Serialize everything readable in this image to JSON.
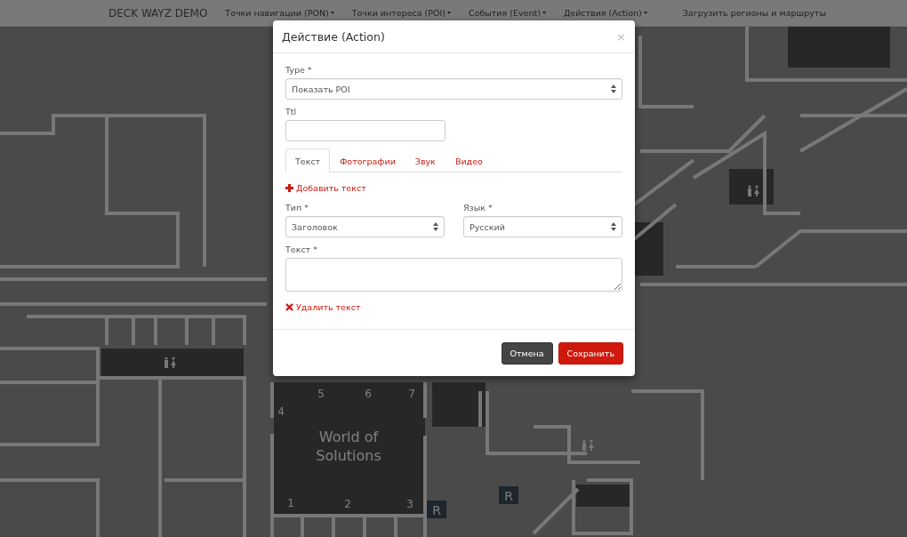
{
  "navbar": {
    "brand": "DECK WAYZ DEMO",
    "menus": [
      {
        "label": "Точки навигации (PON)"
      },
      {
        "label": "Точки интереса (POI)"
      },
      {
        "label": "События (Event)"
      },
      {
        "label": "Действия (Action)"
      }
    ],
    "right_link": "Загрузить регионы и маршруты"
  },
  "map": {
    "labels": [
      {
        "kind": "number",
        "lines": [
          "5"
        ]
      },
      {
        "kind": "number",
        "lines": [
          "6"
        ]
      },
      {
        "kind": "number",
        "lines": [
          "7"
        ]
      },
      {
        "kind": "number",
        "lines": [
          "4"
        ]
      },
      {
        "kind": "area",
        "lines": [
          "World of",
          "Solutions"
        ]
      },
      {
        "kind": "number",
        "lines": [
          "1"
        ]
      },
      {
        "kind": "number",
        "lines": [
          "2"
        ]
      },
      {
        "kind": "number",
        "lines": [
          "3"
        ]
      },
      {
        "kind": "marker",
        "lines": [
          "R"
        ]
      },
      {
        "kind": "marker",
        "lines": [
          "R"
        ]
      }
    ]
  },
  "dialog": {
    "title": "Действие (Action)",
    "close": "×",
    "fields": [
      {
        "kind": "select",
        "label": "Type *",
        "value": "Показать POI"
      },
      {
        "kind": "input",
        "label": "Ttl"
      }
    ],
    "tabs": [
      {
        "label": "Текст",
        "selected": true
      },
      {
        "label": "Фотографии",
        "selected": false
      },
      {
        "label": "Звук",
        "selected": false
      },
      {
        "label": "Видео",
        "selected": false
      }
    ],
    "add_link": "Добавить текст",
    "text_entry": {
      "type": {
        "label": "Тип *",
        "value": "Заголовок"
      },
      "language": {
        "label": "Язык *",
        "value": "Русский"
      },
      "text": {
        "label": "Текст *"
      }
    },
    "remove_link": "Удалить текст",
    "buttons": [
      {
        "kind": "secondary",
        "label": "Отмена"
      },
      {
        "kind": "primary",
        "label": "Сохранить"
      }
    ]
  }
}
